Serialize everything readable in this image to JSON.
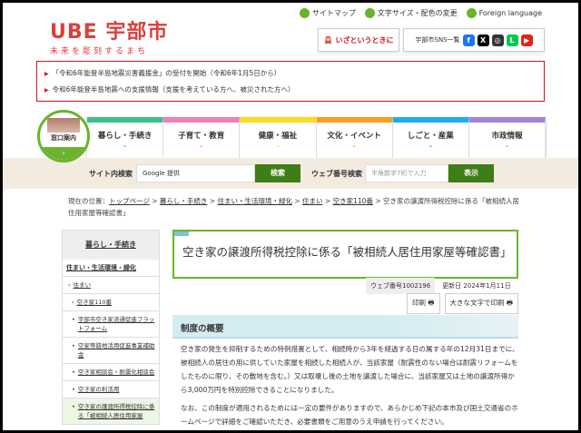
{
  "header": {
    "logo_main": "UBE 宇部市",
    "logo_sub": "未来を彫刻するまち",
    "links": [
      {
        "label": "サイトマップ",
        "icon": "sitemap-icon"
      },
      {
        "label": "文字サイズ・配色の変更",
        "icon": "font-size-icon"
      },
      {
        "label": "Foreign language",
        "icon": "globe-icon"
      }
    ],
    "emergency": "いざというときに",
    "sns_label": "宇部市SNS一覧",
    "sns": [
      {
        "name": "facebook",
        "glyph": "f",
        "color": "#1877f2"
      },
      {
        "name": "x",
        "glyph": "X",
        "color": "#000000"
      },
      {
        "name": "instagram",
        "glyph": "◎",
        "color": "#333333"
      },
      {
        "name": "line",
        "glyph": "L",
        "color": "#06c755"
      },
      {
        "name": "youtube",
        "glyph": "▶",
        "color": "#e62117"
      }
    ]
  },
  "notices": [
    "「令和6年能登半島地震災害義援金」の受付を開始（令和6年1月5日から）",
    "令和6年能登半島地震への支援情報（支援を考えている方へ、被災された方へ）"
  ],
  "madoguchi": {
    "label": "窓口案内",
    "arrow": "›"
  },
  "nav": [
    {
      "label": "暮らし・手続き",
      "color": "#3cc08e"
    },
    {
      "label": "子育て・教育",
      "color": "#ee82b4"
    },
    {
      "label": "健康・福祉",
      "color": "#fadb1f"
    },
    {
      "label": "文化・イベント",
      "color": "#f5a11d"
    },
    {
      "label": "しごと・産業",
      "color": "#1faee8"
    },
    {
      "label": "市政情報",
      "color": "#a385d6"
    }
  ],
  "search": {
    "site_label": "サイト内検索",
    "site_placeholder": "Google 提供",
    "site_button": "検索",
    "web_label": "ウェブ番号検索",
    "web_placeholder": "半角数字7桁で入力",
    "web_button": "表示"
  },
  "breadcrumb": {
    "prefix": "現在の位置：",
    "items": [
      "トップページ",
      "暮らし・手続き",
      "住まい・生活環境・緑化",
      "住まい",
      "空き家110番"
    ],
    "current": "空き家の譲渡所得税控除に係る「被相続人居住用家屋等確認書」"
  },
  "sidebar": {
    "heading": "暮らし・手続き",
    "level1": "住まい・生活環境・緑化",
    "items": [
      {
        "label": "住まい",
        "mark": "›"
      },
      {
        "label": "空き家110番",
        "mark": "›"
      },
      {
        "label": "宇部市空き家流通促進プラットフォーム",
        "mark": "•"
      },
      {
        "label": "空家等跡地活用促進事業補助金",
        "mark": "•"
      },
      {
        "label": "空き家相談会・耐震化相談会",
        "mark": "•"
      },
      {
        "label": "空き家の利活用",
        "mark": "•"
      },
      {
        "label": "空き家の譲渡所得税控除に係る「被相続人居住用家屋",
        "mark": "•"
      }
    ]
  },
  "main": {
    "title": "空き家の譲渡所得税控除に係る「被相続人居住用家屋等確認書」",
    "web_number": "ウェブ番号1002196",
    "updated": "更新日 2024年1月11日",
    "print": "印刷",
    "print_large": "大きな文字で印刷",
    "section": "制度の概要",
    "paragraphs": [
      "空き家の発生を抑制するための特例措置として、相続時から3年を経過する日の属する年の12月31日までに、被相続人の居住の用に供していた家屋を相続した相続人が、当該家屋（耐震性のない場合は耐震リフォームをしたものに限り、その敷地を含む。）又は取壊し後の土地を譲渡した場合に、当該家屋又は土地の譲渡所得から3,000万円を特別控除できることになりました。",
      "なお、この制度が適用されるためには一定の要件がありますので、あらかじめ下記の本市及び国土交通省のホームページで詳細をご確認いただき、必要書類をご用意のうえ申請を行ってください。"
    ]
  }
}
